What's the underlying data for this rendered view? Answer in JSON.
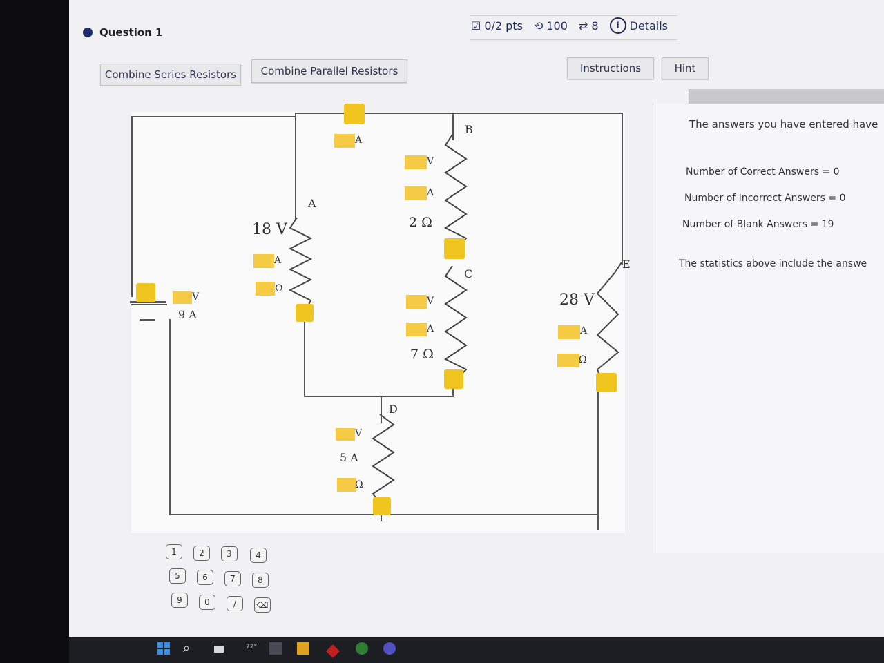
{
  "question": {
    "title": "Question 1"
  },
  "status": {
    "points": "0/2 pts",
    "attempts": "100",
    "retries": "8",
    "details": "Details"
  },
  "toolbar": {
    "combine_series": "Combine Series Resistors",
    "combine_parallel": "Combine Parallel Resistors",
    "instructions": "Instructions",
    "hint": "Hint"
  },
  "side_panel": {
    "intro": "The answers you have entered have",
    "correct": "Number of Correct Answers = 0",
    "incorrect": "Number of Incorrect Answers = 0",
    "blank": "Number of Blank Answers = 19",
    "note": "The statistics above include the answe"
  },
  "circuit": {
    "nodes": {
      "a": "A",
      "b": "B",
      "c": "C",
      "d": "D",
      "e": "E"
    },
    "battery": {
      "volt_unit": "V",
      "current": "9 A"
    },
    "r18": {
      "voltage": "18 V",
      "amp_unit": "A",
      "ohm_unit": "Ω"
    },
    "top_amp_unit": "A",
    "r2": {
      "volt_unit": "V",
      "amp_unit": "A",
      "resistance": "2 Ω"
    },
    "r7": {
      "volt_unit": "V",
      "amp_unit": "A",
      "resistance": "7 Ω"
    },
    "r28": {
      "voltage": "28 V",
      "amp_unit": "A",
      "ohm_unit": "Ω"
    },
    "rd": {
      "volt_unit": "V",
      "current": "5 A",
      "ohm_unit": "Ω"
    }
  },
  "keypad": [
    "1",
    "2",
    "3",
    "4",
    "5",
    "6",
    "7",
    "8",
    "9",
    "0",
    "/",
    "⌫"
  ],
  "taskbar": {
    "weather": "72°"
  },
  "colors": {
    "answer_box": "#f4c430",
    "accent": "#1a2a6c"
  }
}
